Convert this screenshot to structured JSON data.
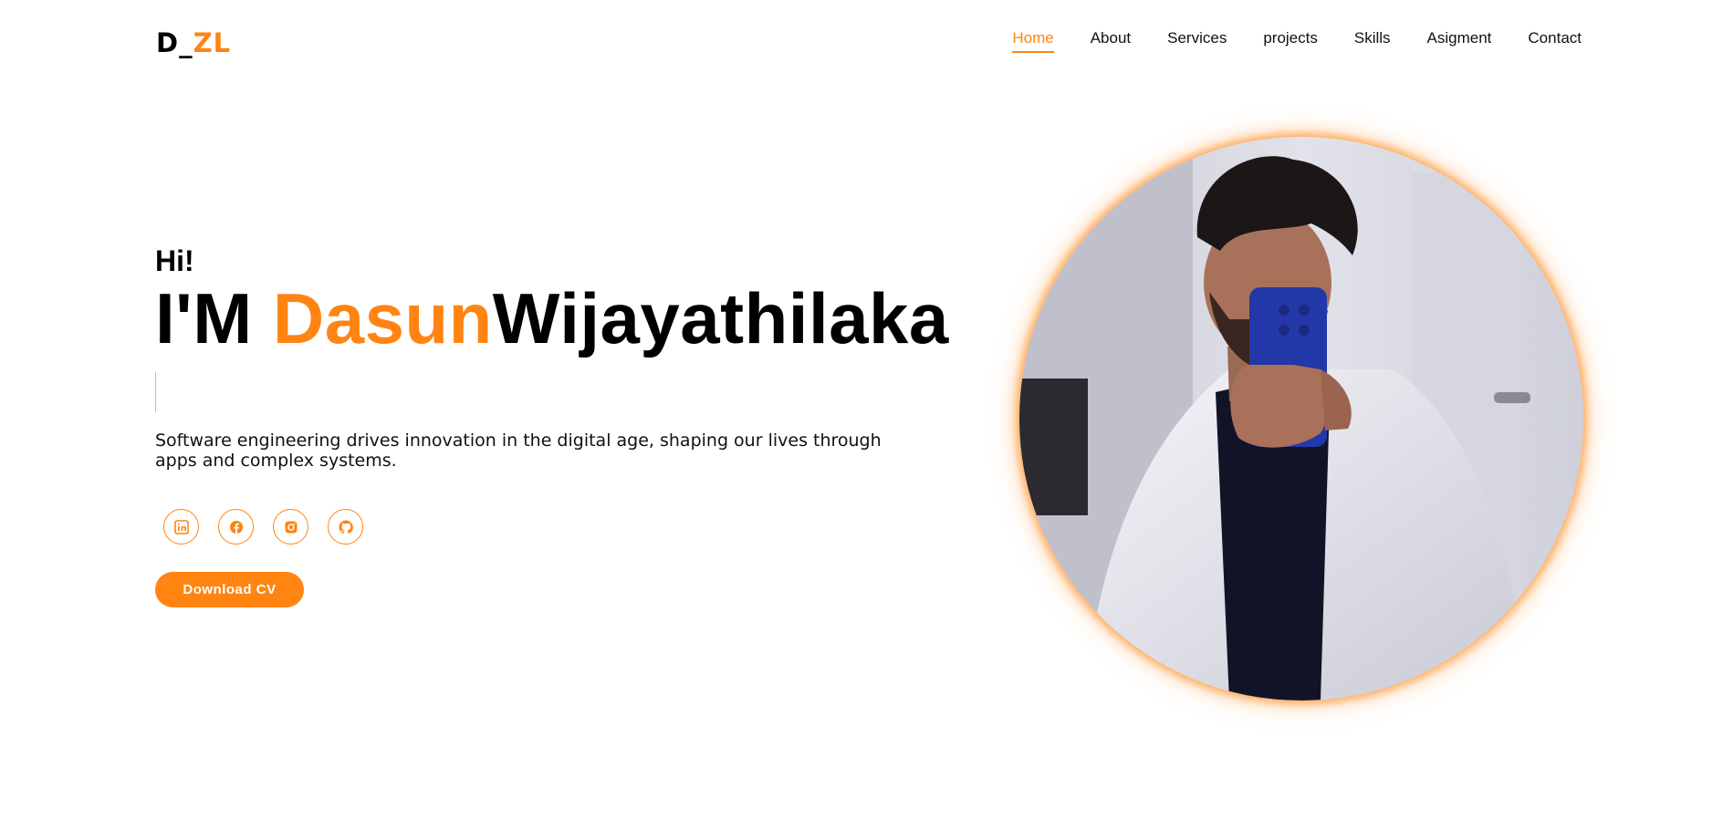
{
  "logo": {
    "part1": "D_",
    "part2": "ZL"
  },
  "nav": {
    "items": [
      {
        "label": "Home",
        "active": true
      },
      {
        "label": "About"
      },
      {
        "label": "Services"
      },
      {
        "label": "projects"
      },
      {
        "label": "Skills"
      },
      {
        "label": "Asigment"
      },
      {
        "label": "Contact"
      }
    ]
  },
  "hero": {
    "greeting": "Hi!",
    "prefix": "I'M ",
    "first_name": "Dasun",
    "last_name": "Wijayathilaka",
    "description": "Software engineering drives innovation in the digital age, shaping our lives through apps and complex systems.",
    "socials": [
      {
        "icon": "linkedin-icon"
      },
      {
        "icon": "facebook-icon"
      },
      {
        "icon": "instagram-icon"
      },
      {
        "icon": "github-icon"
      }
    ],
    "cv_button": "Download CV"
  },
  "colors": {
    "accent": "#ff8412",
    "text": "#000000",
    "background": "#ffffff"
  }
}
